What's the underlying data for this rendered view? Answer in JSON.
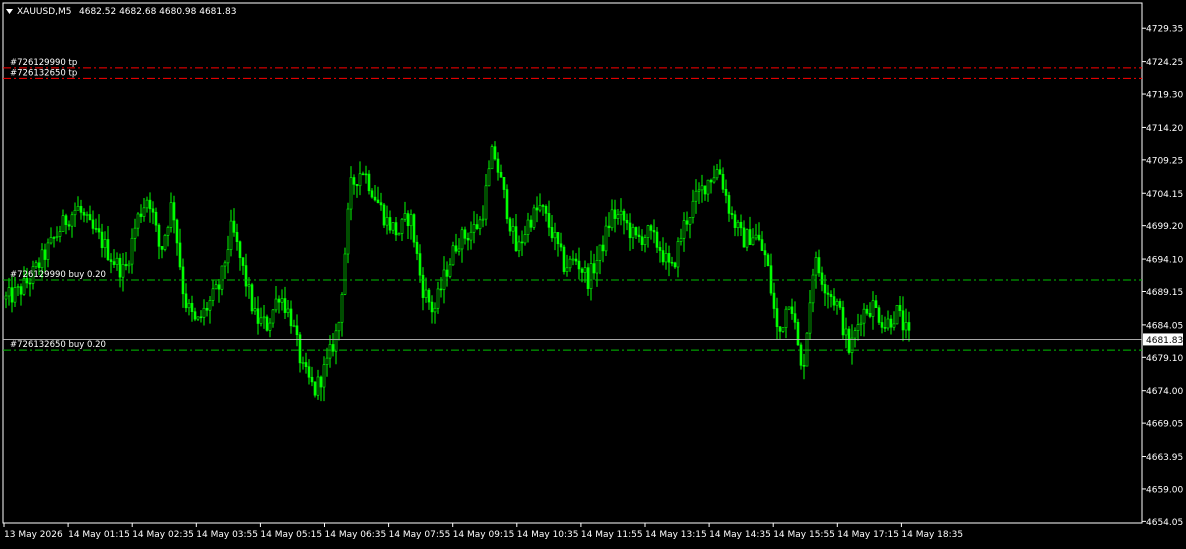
{
  "header": {
    "symbol": "XAUUSD,M5",
    "ohlc": "4682.52 4682.68 4680.98 4681.83",
    "menu_icon": "triangle-down-icon"
  },
  "colors": {
    "background": "#000000",
    "frame": "#ffffff",
    "candle": "#00ff00",
    "tp_line": "#ff0000",
    "order_line": "#00c000",
    "bid_line": "#c0c0c0"
  },
  "levels": [
    {
      "label": "#726129990 tp",
      "price": 4723.3,
      "kind": "tp"
    },
    {
      "label": "#726132650 tp",
      "price": 4721.7,
      "kind": "tp"
    },
    {
      "label": "#726129990 buy 0.20",
      "price": 4690.9,
      "kind": "order"
    },
    {
      "label": "#726132650 buy 0.20",
      "price": 4680.2,
      "kind": "order"
    }
  ],
  "bid": {
    "price": 4681.83,
    "label": "4681.83"
  },
  "chart_data": {
    "type": "bar",
    "title": "XAUUSD,M5",
    "ylim": [
      4653.8,
      4733.2
    ],
    "y_ticks": [
      "4729.35",
      "4724.25",
      "4719.30",
      "4714.20",
      "4709.25",
      "4704.15",
      "4699.20",
      "4694.10",
      "4689.15",
      "4684.05",
      "4679.10",
      "4674.00",
      "4669.05",
      "4663.95",
      "4659.00",
      "4654.05"
    ],
    "x_ticks": [
      "13 May 2026",
      "14 May 01:15",
      "14 May 02:35",
      "14 May 03:55",
      "14 May 05:15",
      "14 May 06:35",
      "14 May 07:55",
      "14 May 09:15",
      "14 May 10:35",
      "14 May 11:55",
      "14 May 13:15",
      "14 May 14:35",
      "14 May 15:55",
      "14 May 17:15",
      "14 May 18:35"
    ],
    "close_keys": [
      4688,
      4689,
      4691,
      4694,
      4697,
      4700,
      4702,
      4699,
      4697,
      4694,
      4692,
      4700,
      4704,
      4695,
      4703,
      4688,
      4684,
      4687,
      4690,
      4699,
      4692,
      4685,
      4684,
      4689,
      4685,
      4677,
      4674,
      4678,
      4684,
      4705,
      4708,
      4704,
      4700,
      4698,
      4701,
      4690,
      4686,
      4692,
      4697,
      4698,
      4700,
      4711,
      4703,
      4695,
      4700,
      4702,
      4698,
      4693,
      4694,
      4691,
      4695,
      4701,
      4700,
      4697,
      4698,
      4696,
      4692,
      4699,
      4703,
      4706,
      4708,
      4701,
      4697,
      4698,
      4694,
      4682,
      4689,
      4676,
      4694,
      4690,
      4687,
      4680,
      4686,
      4687,
      4684,
      4686,
      4682
    ]
  }
}
